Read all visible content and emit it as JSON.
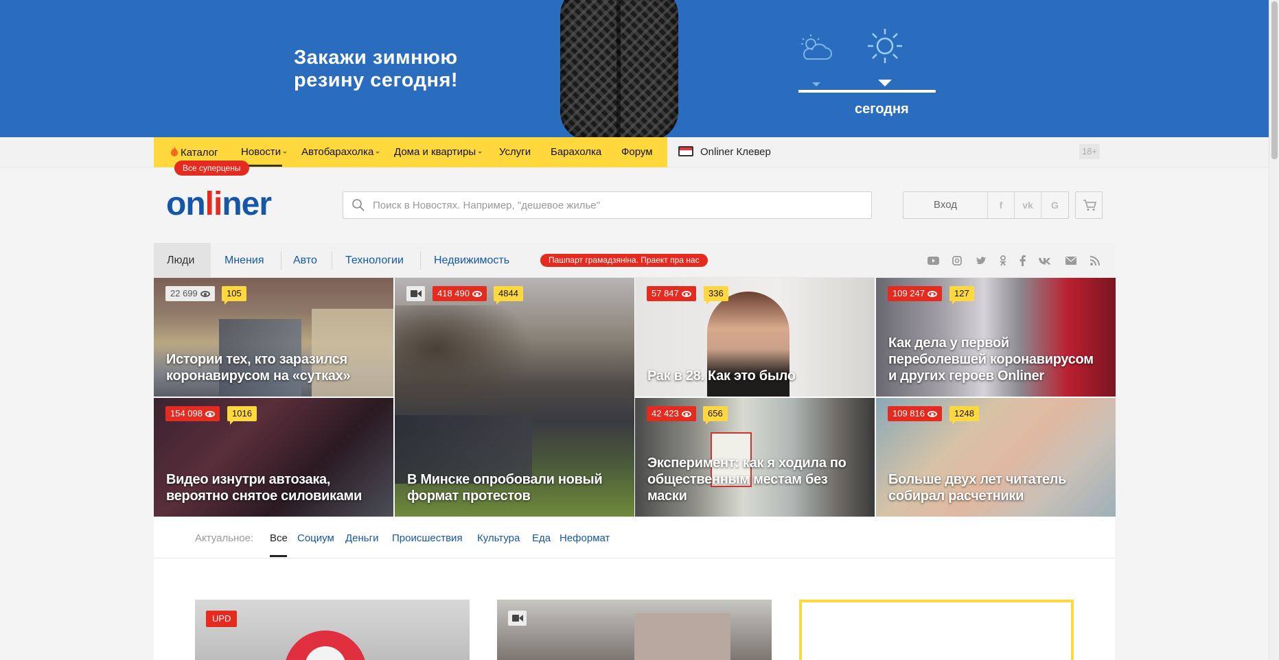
{
  "banner": {
    "headline_line1": "Закажи зимнюю",
    "headline_line2": "резину  сегодня!",
    "weather_label": "сегодня"
  },
  "topnav": {
    "items": [
      {
        "label": "Каталог",
        "has_caret": false
      },
      {
        "label": "Новости",
        "has_caret": true
      },
      {
        "label": "Автобарахолка",
        "has_caret": true
      },
      {
        "label": "Дома и квартиры",
        "has_caret": true
      },
      {
        "label": "Услуги",
        "has_caret": false
      },
      {
        "label": "Барахолка",
        "has_caret": false
      },
      {
        "label": "Форум",
        "has_caret": false
      }
    ],
    "sale_badge": "Все суперцены",
    "clever": "Onliner Клевер",
    "age": "18+"
  },
  "header": {
    "logo_part1": "on",
    "logo_part2": "li",
    "logo_part3": "ner",
    "search_placeholder": "Поиск в Новостях. Например, \"дешевое жилье\"",
    "login": "Вход",
    "social": [
      "f",
      "vk",
      "G"
    ]
  },
  "sections": {
    "items": [
      "Люди",
      "Мнения",
      "Авто",
      "Технологии",
      "Недвижимость"
    ],
    "active": "Люди",
    "badge": "Пашпарт грамадзяніна. Праект пра нас",
    "social_icons": [
      "youtube-icon",
      "instagram-icon",
      "twitter-icon",
      "odnoklassniki-icon",
      "facebook-icon",
      "vk-icon",
      "mail-icon",
      "rss-icon"
    ]
  },
  "tiles": [
    {
      "views": "22 699",
      "comments": "105",
      "title": "Истории тех, кто заразился коронавирусом на «сутках»",
      "views_style": "gray",
      "video": false
    },
    {
      "views": "418 490",
      "comments": "4844",
      "title": "",
      "views_style": "red",
      "video": true
    },
    {
      "views": "57 847",
      "comments": "336",
      "title": "Рак в 28. Как это было",
      "views_style": "red",
      "video": false
    },
    {
      "views": "109 247",
      "comments": "127",
      "title": "Как дела у первой переболевшей коронавирусом и других героев Onliner",
      "views_style": "red",
      "video": false
    },
    {
      "views": "154 098",
      "comments": "1016",
      "title": "Видео изнутри автозака, вероятно снятое силовиками",
      "views_style": "red",
      "video": false
    },
    {
      "views": "",
      "comments": "",
      "title": "В Минске опробовали новый формат протестов",
      "views_style": "none",
      "video": false
    },
    {
      "views": "42 423",
      "comments": "656",
      "title": "Эксперимент: как я ходила по общественным местам без маски",
      "views_style": "red",
      "video": false
    },
    {
      "views": "109 816",
      "comments": "1248",
      "title": "Больше двух лет читатель собирал расчетники",
      "views_style": "red",
      "video": false
    }
  ],
  "actual": {
    "label": "Актуальное:",
    "tabs": [
      "Все",
      "Социум",
      "Деньги",
      "Происшествия",
      "Культура",
      "Еда",
      "Неформат"
    ],
    "active": "Все"
  },
  "cards": {
    "upd_badge": "UPD"
  },
  "colors": {
    "banner_blue": "#2a6dbf",
    "brand_yellow": "#ffd83e",
    "brand_red": "#e52a20",
    "link_blue": "#1457a8"
  }
}
